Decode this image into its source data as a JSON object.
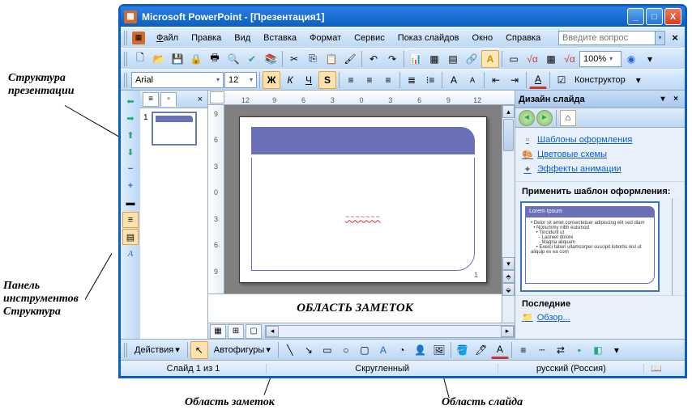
{
  "external_labels": {
    "structure": "Структура\nпрезентации",
    "toolbar": "Панель\nинструментов\nСтруктура",
    "notes": "Область заметок",
    "slide": "Область слайда"
  },
  "titlebar": {
    "app": "Microsoft PowerPoint",
    "doc": "[Презентация1]"
  },
  "menus": {
    "file": "Файл",
    "edit": "Правка",
    "view": "Вид",
    "insert": "Вставка",
    "format": "Формат",
    "tools": "Сервис",
    "slideshow": "Показ слайдов",
    "window": "Окно",
    "help": "Справка"
  },
  "question_box": {
    "placeholder": "Введите вопрос"
  },
  "format_toolbar": {
    "font": "Arial",
    "size": "12",
    "designer": "Конструктор",
    "zoom": "100%"
  },
  "ruler": {
    "h": [
      "12",
      "9",
      "6",
      "3",
      "0",
      "3",
      "6",
      "9",
      "12"
    ],
    "v": [
      "9",
      "6",
      "3",
      "0",
      "3",
      "6",
      "9"
    ]
  },
  "thumbs": [
    {
      "num": "1"
    }
  ],
  "slide": {
    "squiggle": "~~~~~~~",
    "page": "1"
  },
  "notes_text": "ОБЛАСТЬ ЗАМЕТОК",
  "taskpane": {
    "title": "Дизайн слайда",
    "links": {
      "templates": "Шаблоны оформления",
      "colors": "Цветовые схемы",
      "anim": "Эффекты анимации"
    },
    "apply": "Применить шаблон оформления:",
    "preview_title": "Lorem Ipsum",
    "preview_body": "• Delor sit amet consectetuer adipiscing elit sed diam\n  • Nonummy nibh euismod\n    • Tincidunt ut\n      - Laoreet dolore\n      - Magna aliquam\n    • Exerci tation ullamcorper suscipit lobortis nisl ut aliquip ex ea com",
    "recent": "Последние",
    "browse": "Обзор..."
  },
  "drawbar": {
    "actions": "Действия",
    "autoshapes": "Автофигуры"
  },
  "status": {
    "slide": "Слайд 1 из 1",
    "layout": "Скругленный",
    "lang": "русский (Россия)"
  }
}
